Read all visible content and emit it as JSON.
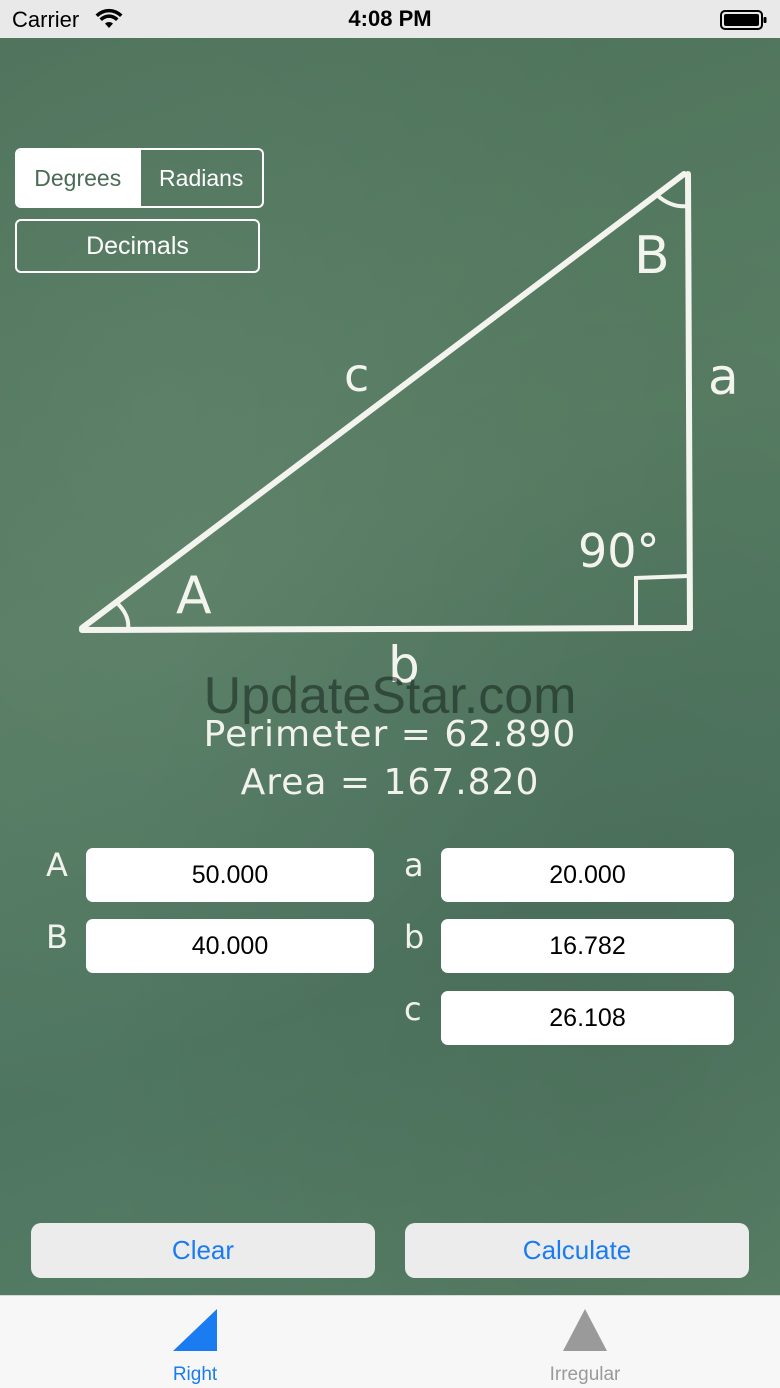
{
  "status_bar": {
    "carrier": "Carrier",
    "time": "4:08 PM"
  },
  "angle_unit": {
    "options": [
      "Degrees",
      "Radians"
    ],
    "selected": "Degrees"
  },
  "format_button": "Decimals",
  "diagram": {
    "vertex_a": "A",
    "vertex_b": "B",
    "side_a": "a",
    "side_b": "b",
    "side_c": "c",
    "right_angle": "90°"
  },
  "watermark": "UpdateStar.com",
  "results": {
    "perimeter": "Perimeter = 62.890",
    "area": "Area = 167.820"
  },
  "fields": {
    "A": {
      "label": "A",
      "value": "50.000"
    },
    "B": {
      "label": "B",
      "value": "40.000"
    },
    "a": {
      "label": "a",
      "value": "20.000"
    },
    "b": {
      "label": "b",
      "value": "16.782"
    },
    "c": {
      "label": "c",
      "value": "26.108"
    }
  },
  "buttons": {
    "clear": "Clear",
    "calculate": "Calculate"
  },
  "tabs": [
    {
      "label": "Right",
      "selected": true
    },
    {
      "label": "Irregular",
      "selected": false
    }
  ],
  "colors": {
    "accent": "#1a7cf0",
    "board": "#537a60",
    "inactive_tab": "#9a9a9a"
  }
}
